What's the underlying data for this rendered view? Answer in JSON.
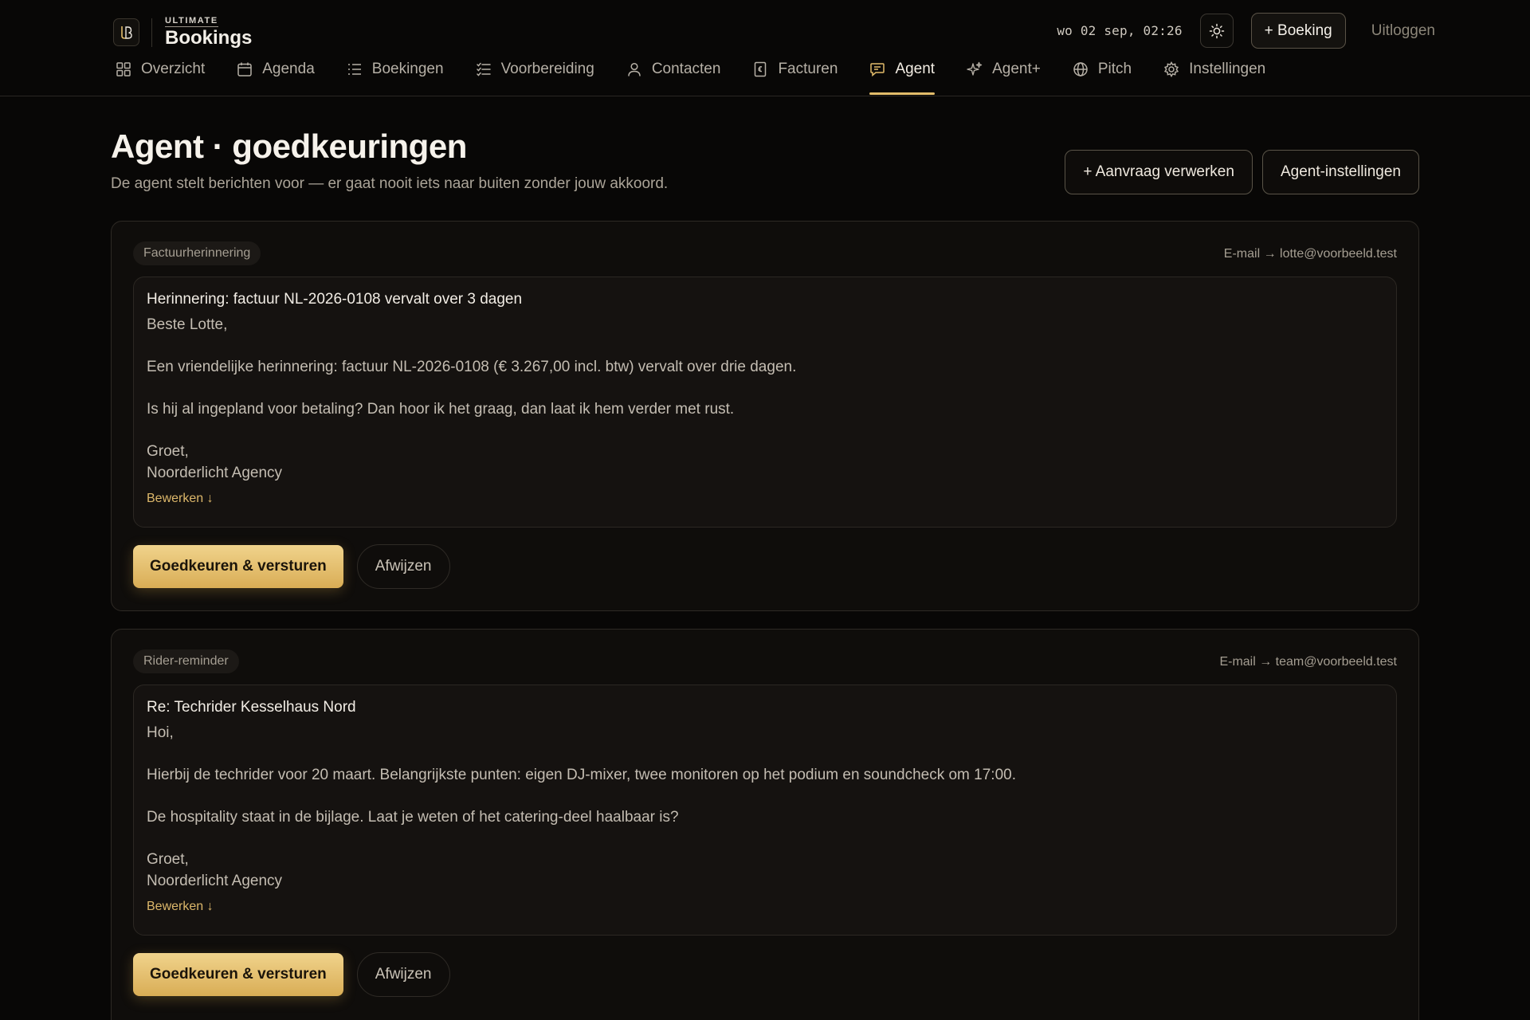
{
  "brand": {
    "top": "ULTIMATE",
    "main": "Bookings"
  },
  "header": {
    "datetime": "wo 02 sep, 02:26",
    "new_booking_label": "+ Boeking",
    "logout_label": "Uitloggen"
  },
  "nav": {
    "items": [
      {
        "label": "Overzicht",
        "icon": "grid-icon"
      },
      {
        "label": "Agenda",
        "icon": "calendar-icon"
      },
      {
        "label": "Boekingen",
        "icon": "list-icon"
      },
      {
        "label": "Voorbereiding",
        "icon": "checklist-icon"
      },
      {
        "label": "Contacten",
        "icon": "user-icon"
      },
      {
        "label": "Facturen",
        "icon": "invoice-icon"
      },
      {
        "label": "Agent",
        "icon": "chat-icon",
        "active": true
      },
      {
        "label": "Agent+",
        "icon": "sparkle-icon"
      },
      {
        "label": "Pitch",
        "icon": "globe-icon"
      },
      {
        "label": "Instellingen",
        "icon": "gear-icon"
      }
    ]
  },
  "page": {
    "title": "Agent · goedkeuringen",
    "subtitle": "De agent stelt berichten voor — er gaat nooit iets naar buiten zonder jouw akkoord.",
    "process_request_label": "+ Aanvraag verwerken",
    "agent_settings_label": "Agent-instellingen"
  },
  "cards": [
    {
      "tag": "Factuurherinnering",
      "meta": "E-mail → lotte@voorbeeld.test",
      "subject": "Herinnering: factuur NL-2026-0108 vervalt over 3 dagen",
      "lines": [
        "Beste Lotte,",
        "",
        "Een vriendelijke herinnering: factuur NL-2026-0108 (€ 3.267,00 incl. btw) vervalt over drie dagen.",
        "",
        "Is hij al ingepland voor betaling? Dan hoor ik het graag, dan laat ik hem verder met rust.",
        "",
        "Groet,",
        "Noorderlicht Agency"
      ],
      "edit_label": "Bewerken ↓",
      "approve_label": "Goedkeuren & versturen",
      "reject_label": "Afwijzen"
    },
    {
      "tag": "Rider-reminder",
      "meta": "E-mail → team@voorbeeld.test",
      "subject": "Re: Techrider Kesselhaus Nord",
      "lines": [
        "Hoi,",
        "",
        "Hierbij de techrider voor 20 maart. Belangrijkste punten: eigen DJ-mixer, twee monitoren op het podium en soundcheck om 17:00.",
        "",
        "De hospitality staat in de bijlage. Laat je weten of het catering-deel haalbaar is?",
        "",
        "Groet,",
        "Noorderlicht Agency"
      ],
      "edit_label": "Bewerken ↓",
      "approve_label": "Goedkeuren & versturen",
      "reject_label": "Afwijzen"
    }
  ],
  "colors": {
    "accent": "#e2bc6a",
    "background": "#080706",
    "card": "#0f0d0b"
  }
}
